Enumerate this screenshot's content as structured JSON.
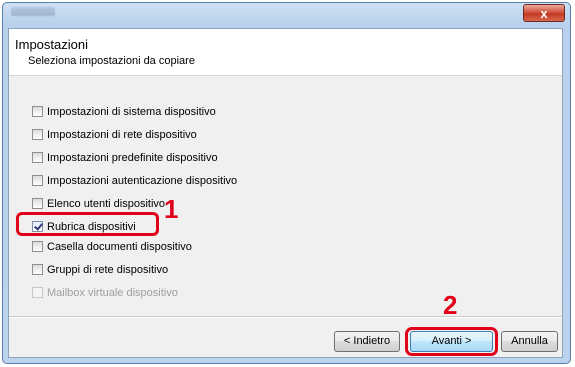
{
  "window": {
    "close_glyph": "x",
    "close_color": "#c7432b"
  },
  "header": {
    "title": "Impostazioni",
    "subtitle": "Seleziona impostazioni da copiare"
  },
  "options": [
    {
      "label": "Impostazioni di sistema dispositivo",
      "checked": false,
      "enabled": true
    },
    {
      "label": "Impostazioni di rete dispositivo",
      "checked": false,
      "enabled": true
    },
    {
      "label": "Impostazioni predefinite dispositivo",
      "checked": false,
      "enabled": true
    },
    {
      "label": "Impostazioni autenticazione dispositivo",
      "checked": false,
      "enabled": true
    },
    {
      "label": "Elenco utenti dispositivo",
      "checked": false,
      "enabled": true
    },
    {
      "label": "Rubrica dispositivi",
      "checked": true,
      "enabled": true
    },
    {
      "label": "Casella documenti dispositivo",
      "checked": false,
      "enabled": true
    },
    {
      "label": "Gruppi di rete dispositivo",
      "checked": false,
      "enabled": true
    },
    {
      "label": "Mailbox virtuale dispositivo",
      "checked": false,
      "enabled": false
    }
  ],
  "callouts": {
    "step1": "1",
    "step2": "2",
    "color": "#e0001a"
  },
  "buttons": {
    "back": "< Indietro",
    "next": "Avanti >",
    "cancel": "Annulla"
  }
}
